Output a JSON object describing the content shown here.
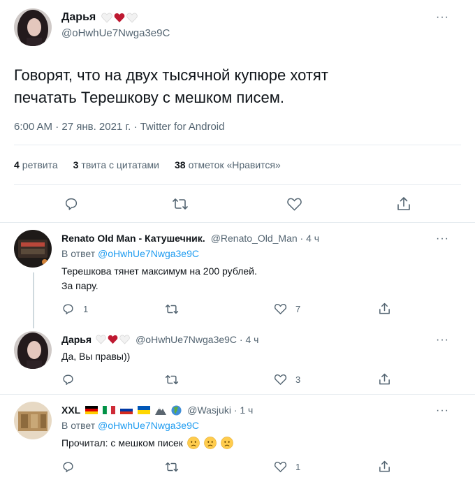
{
  "main_tweet": {
    "name": "Дарья",
    "handle": "@oHwhUe7Nwga3e9C",
    "more": "···",
    "text_line1": "Говорят, что на двух тысячной купюре хотят",
    "text_line2": "печатать Терешкову с мешком писем.",
    "meta": "6:00 AM · 27 янв. 2021 г. · Twitter for Android",
    "stats": [
      {
        "count": "4",
        "label": "ретвита"
      },
      {
        "count": "3",
        "label": "твита с цитатами"
      },
      {
        "count": "38",
        "label": "отметок «Нравится»"
      }
    ],
    "icons": [
      "reply-icon",
      "retweet-icon",
      "like-icon",
      "share-icon"
    ]
  },
  "replies": [
    {
      "name": "Renato Old Man - Катушечник.",
      "handle": "@Renato_Old_Man · 4 ч",
      "in_reply_prefix": "В ответ",
      "in_reply_handle": "@oHwhUe7Nwga3e9C",
      "line1": "Терешкова тянет максимум на 200 рублей.",
      "line2": "За пару.",
      "reply_count": "1",
      "retweet_count": "",
      "like_count": "7",
      "more": "···"
    },
    {
      "name": "Дарья",
      "handle": "@oHwhUe7Nwga3e9C · 4 ч",
      "line1": "Да, Вы правы))",
      "reply_count": "",
      "retweet_count": "",
      "like_count": "3",
      "more": "···"
    },
    {
      "name": "XXL",
      "handle": "@Wasjuki · 1 ч",
      "in_reply_prefix": "В ответ",
      "in_reply_handle": "@oHwhUe7Nwga3e9C",
      "line1": "Прочитал: с мешком писек",
      "reply_count": "",
      "retweet_count": "",
      "like_count": "1",
      "more": "···"
    }
  ],
  "colors": {
    "accent": "#1d9bf0",
    "heart": "#e0245e",
    "text_secondary": "#536471"
  }
}
